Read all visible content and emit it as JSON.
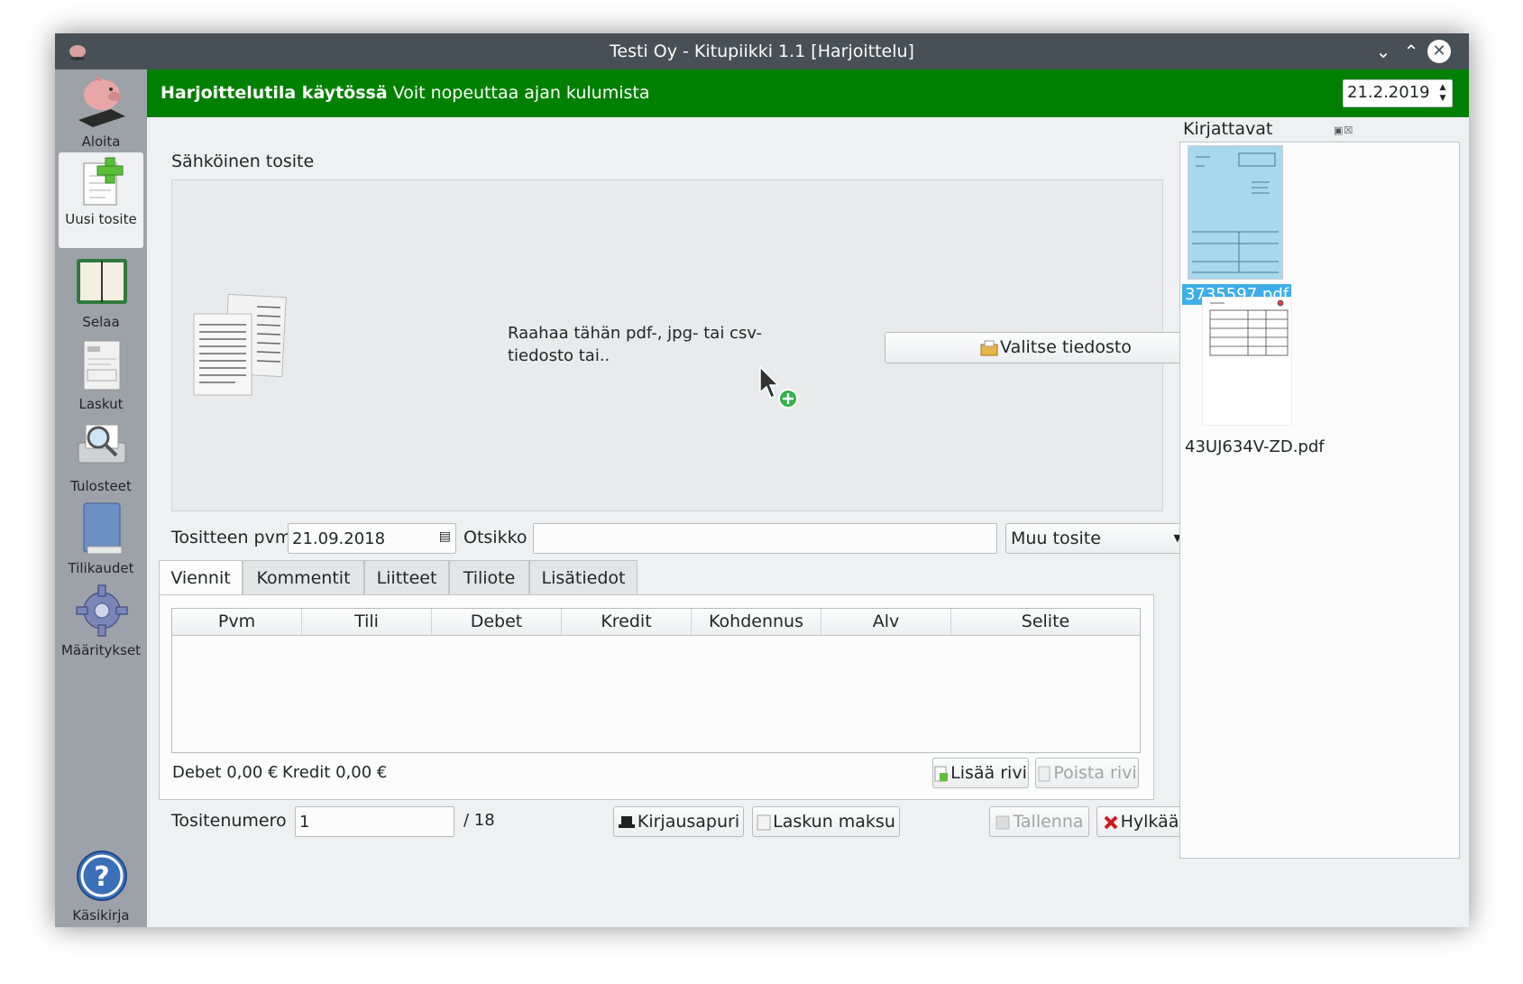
{
  "window": {
    "title": "Testi Oy - Kitupiikki 1.1 [Harjoittelu]"
  },
  "sidebar": {
    "items": [
      {
        "label": "Aloita",
        "icon": "piggy-bank-icon"
      },
      {
        "label": "Uusi tosite",
        "icon": "new-document-icon",
        "active": true
      },
      {
        "label": "Selaa",
        "icon": "calendar-book-icon"
      },
      {
        "label": "Laskut",
        "icon": "invoice-icon"
      },
      {
        "label": "Tulosteet",
        "icon": "print-preview-icon"
      },
      {
        "label": "Tilikaudet",
        "icon": "book-icon"
      },
      {
        "label": "Määritykset",
        "icon": "gear-icon"
      },
      {
        "label": "Käsikirja",
        "icon": "help-icon"
      }
    ]
  },
  "banner": {
    "bold": "Harjoittelutila käytössä",
    "text": "Voit nopeuttaa ajan kulumista",
    "date": "21.2.2019",
    "color": "#008000"
  },
  "main": {
    "section_label": "Sähköinen tosite",
    "drop_text": "Raahaa tähän pdf-, jpg- tai csv-tiedosto tai..",
    "choose_file_button": "Valitse tiedosto",
    "date_label": "Tositteen pvm",
    "date_value": "21.09.2018",
    "title_label": "Otsikko",
    "title_value": "",
    "type_value": "Muu tosite",
    "tabs": [
      "Viennit",
      "Kommentit",
      "Liitteet",
      "Tiliote",
      "Lisätiedot"
    ],
    "table_headers": [
      "Pvm",
      "Tili",
      "Debet",
      "Kredit",
      "Kohdennus",
      "Alv",
      "Selite"
    ],
    "debet_total": "Debet 0,00 €",
    "kredit_total": "Kredit 0,00 €",
    "add_row_button": "Lisää rivi",
    "remove_row_button": "Poista rivi",
    "number_label": "Tositenumero",
    "number_value": "1",
    "number_total": "/ 18",
    "assistant_button": "Kirjausapuri",
    "invoice_payment_button": "Laskun maksu",
    "save_button": "Tallenna",
    "reject_button": "Hylkää",
    "more_button": "⋮"
  },
  "right_panel": {
    "title": "Kirjattavat",
    "files": [
      "3735597.pdf",
      "43UJ634V-ZD.pdf"
    ]
  }
}
